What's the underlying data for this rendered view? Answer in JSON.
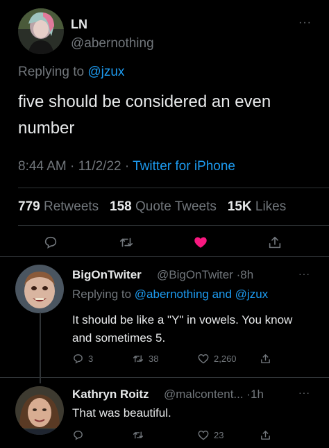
{
  "main_tweet": {
    "name": "LN",
    "handle": "@abernothing",
    "replying_prefix": "Replying to",
    "replying_to": "@jzux",
    "text": "five should be considered an even number",
    "time": "8:44 AM",
    "date": "11/2/22",
    "source": "Twitter for iPhone",
    "sep": "·",
    "stats": {
      "retweets_count": "779",
      "retweets_label": "Retweets",
      "quotes_count": "158",
      "quotes_label": "Quote Tweets",
      "likes_count": "15K",
      "likes_label": "Likes"
    },
    "more": "···"
  },
  "replies": [
    {
      "name": "BigOnTwiter",
      "handle": "@BigOnTwiter",
      "time": "8h",
      "replying_prefix": "Replying to",
      "replying_to": "@abernothing and @jzux",
      "text": "It should be like a \"Y\" in vowels. You know and sometimes 5.",
      "reply_count": "3",
      "retweet_count": "38",
      "like_count": "2,260",
      "more": "···"
    },
    {
      "name": "Kathryn Roitz",
      "handle": "@malcontent...",
      "time": "1h",
      "text": "That was beautiful.",
      "reply_count": "",
      "retweet_count": "",
      "like_count": "23",
      "more": "···"
    }
  ],
  "icons": [
    "reply-icon",
    "retweet-icon",
    "like-icon",
    "share-icon",
    "more-icon"
  ],
  "colors": {
    "background": "#000000",
    "text": "#e7e9ea",
    "muted": "#71767b",
    "link": "#1d9bf0",
    "like_active": "#f91880",
    "divider": "#2f3336"
  }
}
